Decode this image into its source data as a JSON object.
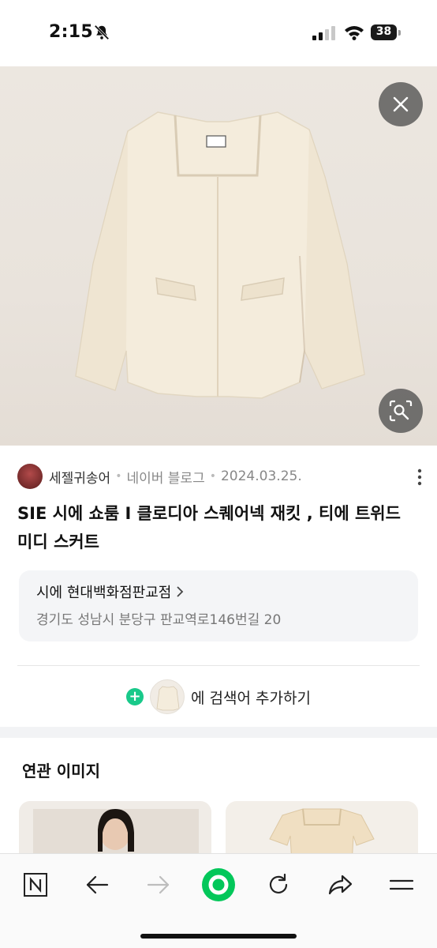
{
  "status_bar": {
    "time": "2:15",
    "battery": "38"
  },
  "result": {
    "source_name": "세젤귀송어",
    "separator": "•",
    "source_type": "네이버 블로그",
    "date": "2024.03.25.",
    "title": "SIE 시에 쇼룸 I 클로디아 스퀘어넥 재킷 , 티에 트위드 미디 스커트"
  },
  "place": {
    "name": "시에 현대백화점판교점",
    "address": "경기도 성남시 분당구 판교역로146번길 20"
  },
  "add_search": {
    "label": "에 검색어 추가하기"
  },
  "related": {
    "title": "연관 이미지"
  },
  "toolbar": {
    "icons": [
      "naver-n-icon",
      "back-arrow-icon",
      "forward-arrow-icon",
      "green-dot-home-icon",
      "refresh-icon",
      "share-icon",
      "menu-icon"
    ]
  },
  "colors": {
    "accent_green": "#03c75a",
    "plus_green": "#19c98a"
  }
}
